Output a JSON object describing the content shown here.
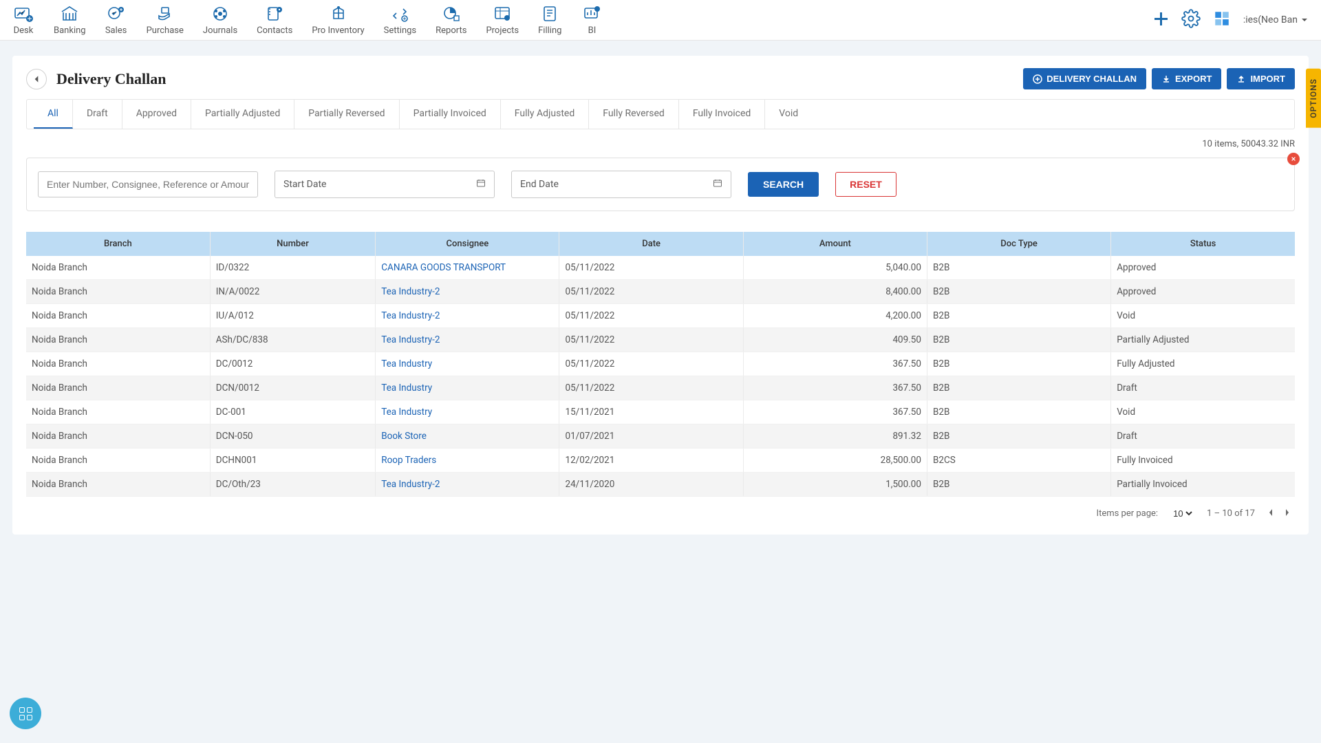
{
  "nav": {
    "items": [
      {
        "label": "Desk"
      },
      {
        "label": "Banking"
      },
      {
        "label": "Sales"
      },
      {
        "label": "Purchase"
      },
      {
        "label": "Journals"
      },
      {
        "label": "Contacts"
      },
      {
        "label": "Pro Inventory"
      },
      {
        "label": "Settings"
      },
      {
        "label": "Reports"
      },
      {
        "label": "Projects"
      },
      {
        "label": "Filling"
      },
      {
        "label": "BI"
      }
    ],
    "org_label": ":ies(Neo Ban"
  },
  "page": {
    "title": "Delivery Challan",
    "actions": {
      "create": "DELIVERY CHALLAN",
      "export": "EXPORT",
      "import": "IMPORT"
    }
  },
  "tabs": {
    "items": [
      "All",
      "Draft",
      "Approved",
      "Partially Adjusted",
      "Partially Reversed",
      "Partially Invoiced",
      "Fully Adjusted",
      "Fully Reversed",
      "Fully Invoiced",
      "Void"
    ],
    "active": 0
  },
  "summary": "10 items, 50043.32 INR",
  "search": {
    "placeholder": "Enter Number, Consignee, Reference or Amount",
    "start_label": "Start Date",
    "end_label": "End Date",
    "search_btn": "SEARCH",
    "reset_btn": "RESET"
  },
  "table": {
    "headers": [
      "Branch",
      "Number",
      "Consignee",
      "Date",
      "Amount",
      "Doc Type",
      "Status"
    ],
    "rows": [
      {
        "branch": "Noida Branch",
        "number": "ID/0322",
        "consignee": "CANARA GOODS TRANSPORT",
        "date": "05/11/2022",
        "amount": "5,040.00",
        "doctype": "B2B",
        "status": "Approved"
      },
      {
        "branch": "Noida Branch",
        "number": "IN/A/0022",
        "consignee": "Tea Industry-2",
        "date": "05/11/2022",
        "amount": "8,400.00",
        "doctype": "B2B",
        "status": "Approved"
      },
      {
        "branch": "Noida Branch",
        "number": "IU/A/012",
        "consignee": "Tea Industry-2",
        "date": "05/11/2022",
        "amount": "4,200.00",
        "doctype": "B2B",
        "status": "Void"
      },
      {
        "branch": "Noida Branch",
        "number": "ASh/DC/838",
        "consignee": "Tea Industry-2",
        "date": "05/11/2022",
        "amount": "409.50",
        "doctype": "B2B",
        "status": "Partially Adjusted"
      },
      {
        "branch": "Noida Branch",
        "number": "DC/0012",
        "consignee": "Tea Industry",
        "date": "05/11/2022",
        "amount": "367.50",
        "doctype": "B2B",
        "status": "Fully Adjusted"
      },
      {
        "branch": "Noida Branch",
        "number": "DCN/0012",
        "consignee": "Tea Industry",
        "date": "05/11/2022",
        "amount": "367.50",
        "doctype": "B2B",
        "status": "Draft"
      },
      {
        "branch": "Noida Branch",
        "number": "DC-001",
        "consignee": "Tea Industry",
        "date": "15/11/2021",
        "amount": "367.50",
        "doctype": "B2B",
        "status": "Void"
      },
      {
        "branch": "Noida Branch",
        "number": "DCN-050",
        "consignee": "Book Store",
        "date": "01/07/2021",
        "amount": "891.32",
        "doctype": "B2B",
        "status": "Draft"
      },
      {
        "branch": "Noida Branch",
        "number": "DCHN001",
        "consignee": "Roop Traders",
        "date": "12/02/2021",
        "amount": "28,500.00",
        "doctype": "B2CS",
        "status": "Fully Invoiced"
      },
      {
        "branch": "Noida Branch",
        "number": "DC/Oth/23",
        "consignee": "Tea Industry-2",
        "date": "24/11/2020",
        "amount": "1,500.00",
        "doctype": "B2B",
        "status": "Partially Invoiced"
      }
    ]
  },
  "paginator": {
    "label": "Items per page:",
    "size": "10",
    "range": "1 – 10 of 17"
  },
  "options_tab": "OPTIONS"
}
